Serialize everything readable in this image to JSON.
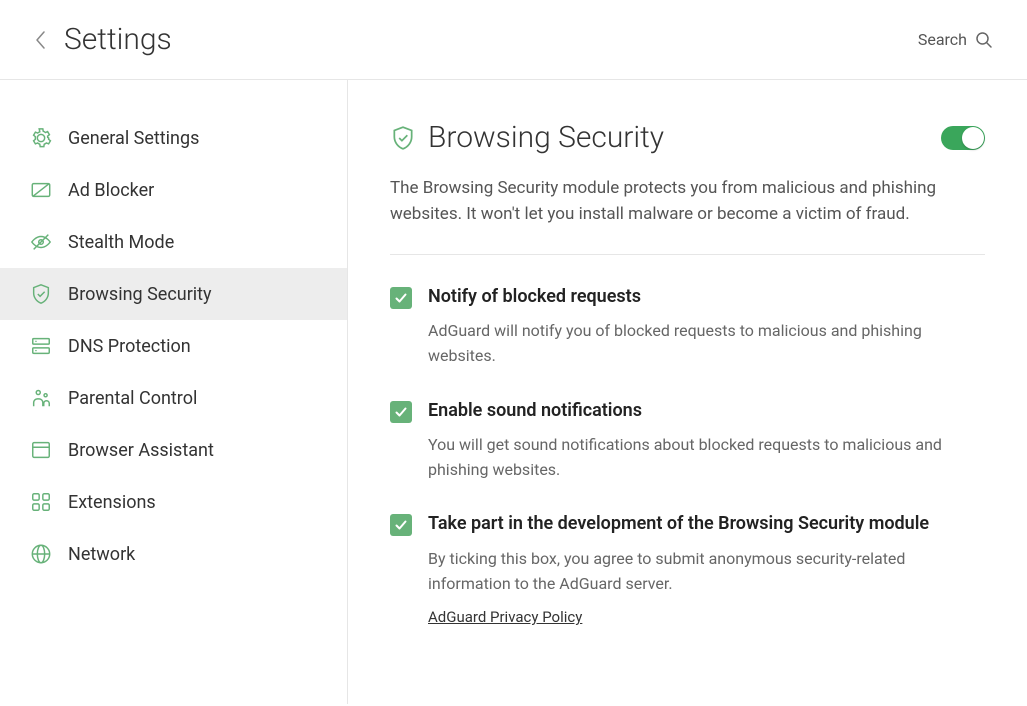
{
  "header": {
    "title": "Settings",
    "search_label": "Search"
  },
  "sidebar": {
    "items": [
      {
        "label": "General Settings"
      },
      {
        "label": "Ad Blocker"
      },
      {
        "label": "Stealth Mode"
      },
      {
        "label": "Browsing Security"
      },
      {
        "label": "DNS Protection"
      },
      {
        "label": "Parental Control"
      },
      {
        "label": "Browser Assistant"
      },
      {
        "label": "Extensions"
      },
      {
        "label": "Network"
      }
    ]
  },
  "main": {
    "title": "Browsing Security",
    "description": "The Browsing Security module protects you from malicious and phishing websites. It won't let you install malware or become a victim of fraud.",
    "toggle_on": true,
    "options": [
      {
        "title": "Notify of blocked requests",
        "desc": "AdGuard will notify you of blocked requests to malicious and phishing websites.",
        "checked": true
      },
      {
        "title": "Enable sound notifications",
        "desc": "You will get sound notifications about blocked requests to malicious and phishing websites.",
        "checked": true
      },
      {
        "title": "Take part in the development of the Browsing Security module",
        "desc": "By ticking this box, you agree to submit anonymous security-related information to the AdGuard server.",
        "checked": true,
        "link": "AdGuard Privacy Policy"
      }
    ]
  },
  "colors": {
    "accent": "#67b279",
    "toggle": "#3aa65b"
  }
}
